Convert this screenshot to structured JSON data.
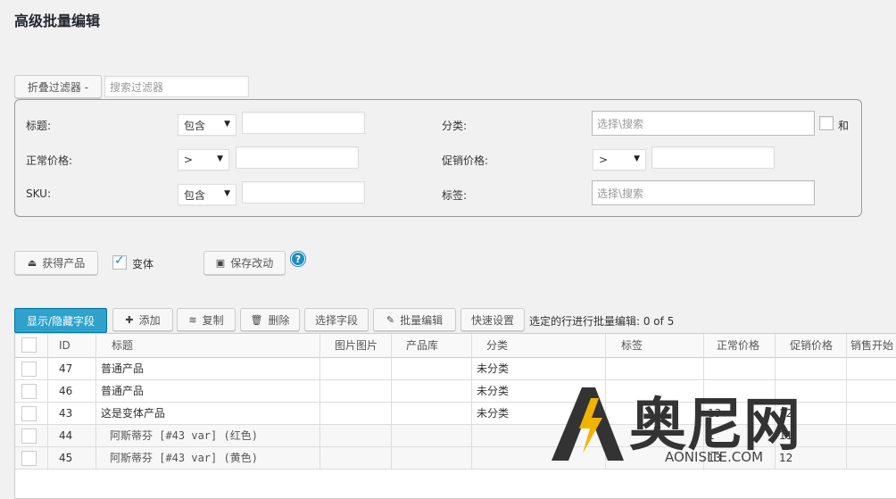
{
  "page_title": "高级批量编辑",
  "filter_toggle": {
    "label": "折叠过滤器 -",
    "search_placeholder": "搜索过滤器"
  },
  "filters": {
    "title": {
      "label": "标题:",
      "op": "包含"
    },
    "regular_price": {
      "label": "正常价格:",
      "op": ">"
    },
    "sku": {
      "label": "SKU:",
      "op": "包含"
    },
    "category": {
      "label": "分类:",
      "placeholder": "选择\\搜索",
      "and_label": "和"
    },
    "sale_price": {
      "label": "促销价格:",
      "op": ">"
    },
    "tags": {
      "label": "标签:",
      "placeholder": "选择\\搜索"
    }
  },
  "actions": {
    "get_products": "获得产品",
    "variations_label": "变体",
    "variations_checked": true,
    "save_changes": "保存改动",
    "help": "?"
  },
  "toolbar": {
    "show_hide_fields": "显示/隐藏字段",
    "add": "添加",
    "duplicate": "复制",
    "delete": "删除",
    "select_fields": "选择字段",
    "bulk_edit": "批量编辑",
    "quick_settings": "快速设置",
    "selection_status": "选定的行进行批量编辑: 0 of 5"
  },
  "table": {
    "columns": [
      "ID",
      "标题",
      "图片图片",
      "产品库",
      "分类",
      "标签",
      "正常价格",
      "促销价格",
      "销售开始"
    ],
    "rows": [
      {
        "id": "47",
        "title": "普通产品",
        "category": "未分类",
        "regular": "",
        "sale": "",
        "child": false
      },
      {
        "id": "46",
        "title": "普通产品",
        "category": "未分类",
        "regular": "",
        "sale": "",
        "child": false
      },
      {
        "id": "43",
        "title": "这是变体产品",
        "category": "未分类",
        "regular": "13",
        "sale": "12",
        "child": false
      },
      {
        "id": "44",
        "title": "阿斯蒂芬 [#43 var] (红色)",
        "category": "",
        "regular": "1",
        "sale": "11",
        "child": true
      },
      {
        "id": "45",
        "title": "阿斯蒂芬 [#43 var] (黄色)",
        "category": "",
        "regular": "13",
        "sale": "12",
        "child": true
      }
    ]
  },
  "watermark": {
    "brand": "奥尼网",
    "domain": "AONISITE.COM",
    "bolt_color": "#f0b400",
    "text_color": "#333333"
  },
  "colors": {
    "primary": "#2ea2cc",
    "link": "#1e8cbe"
  }
}
